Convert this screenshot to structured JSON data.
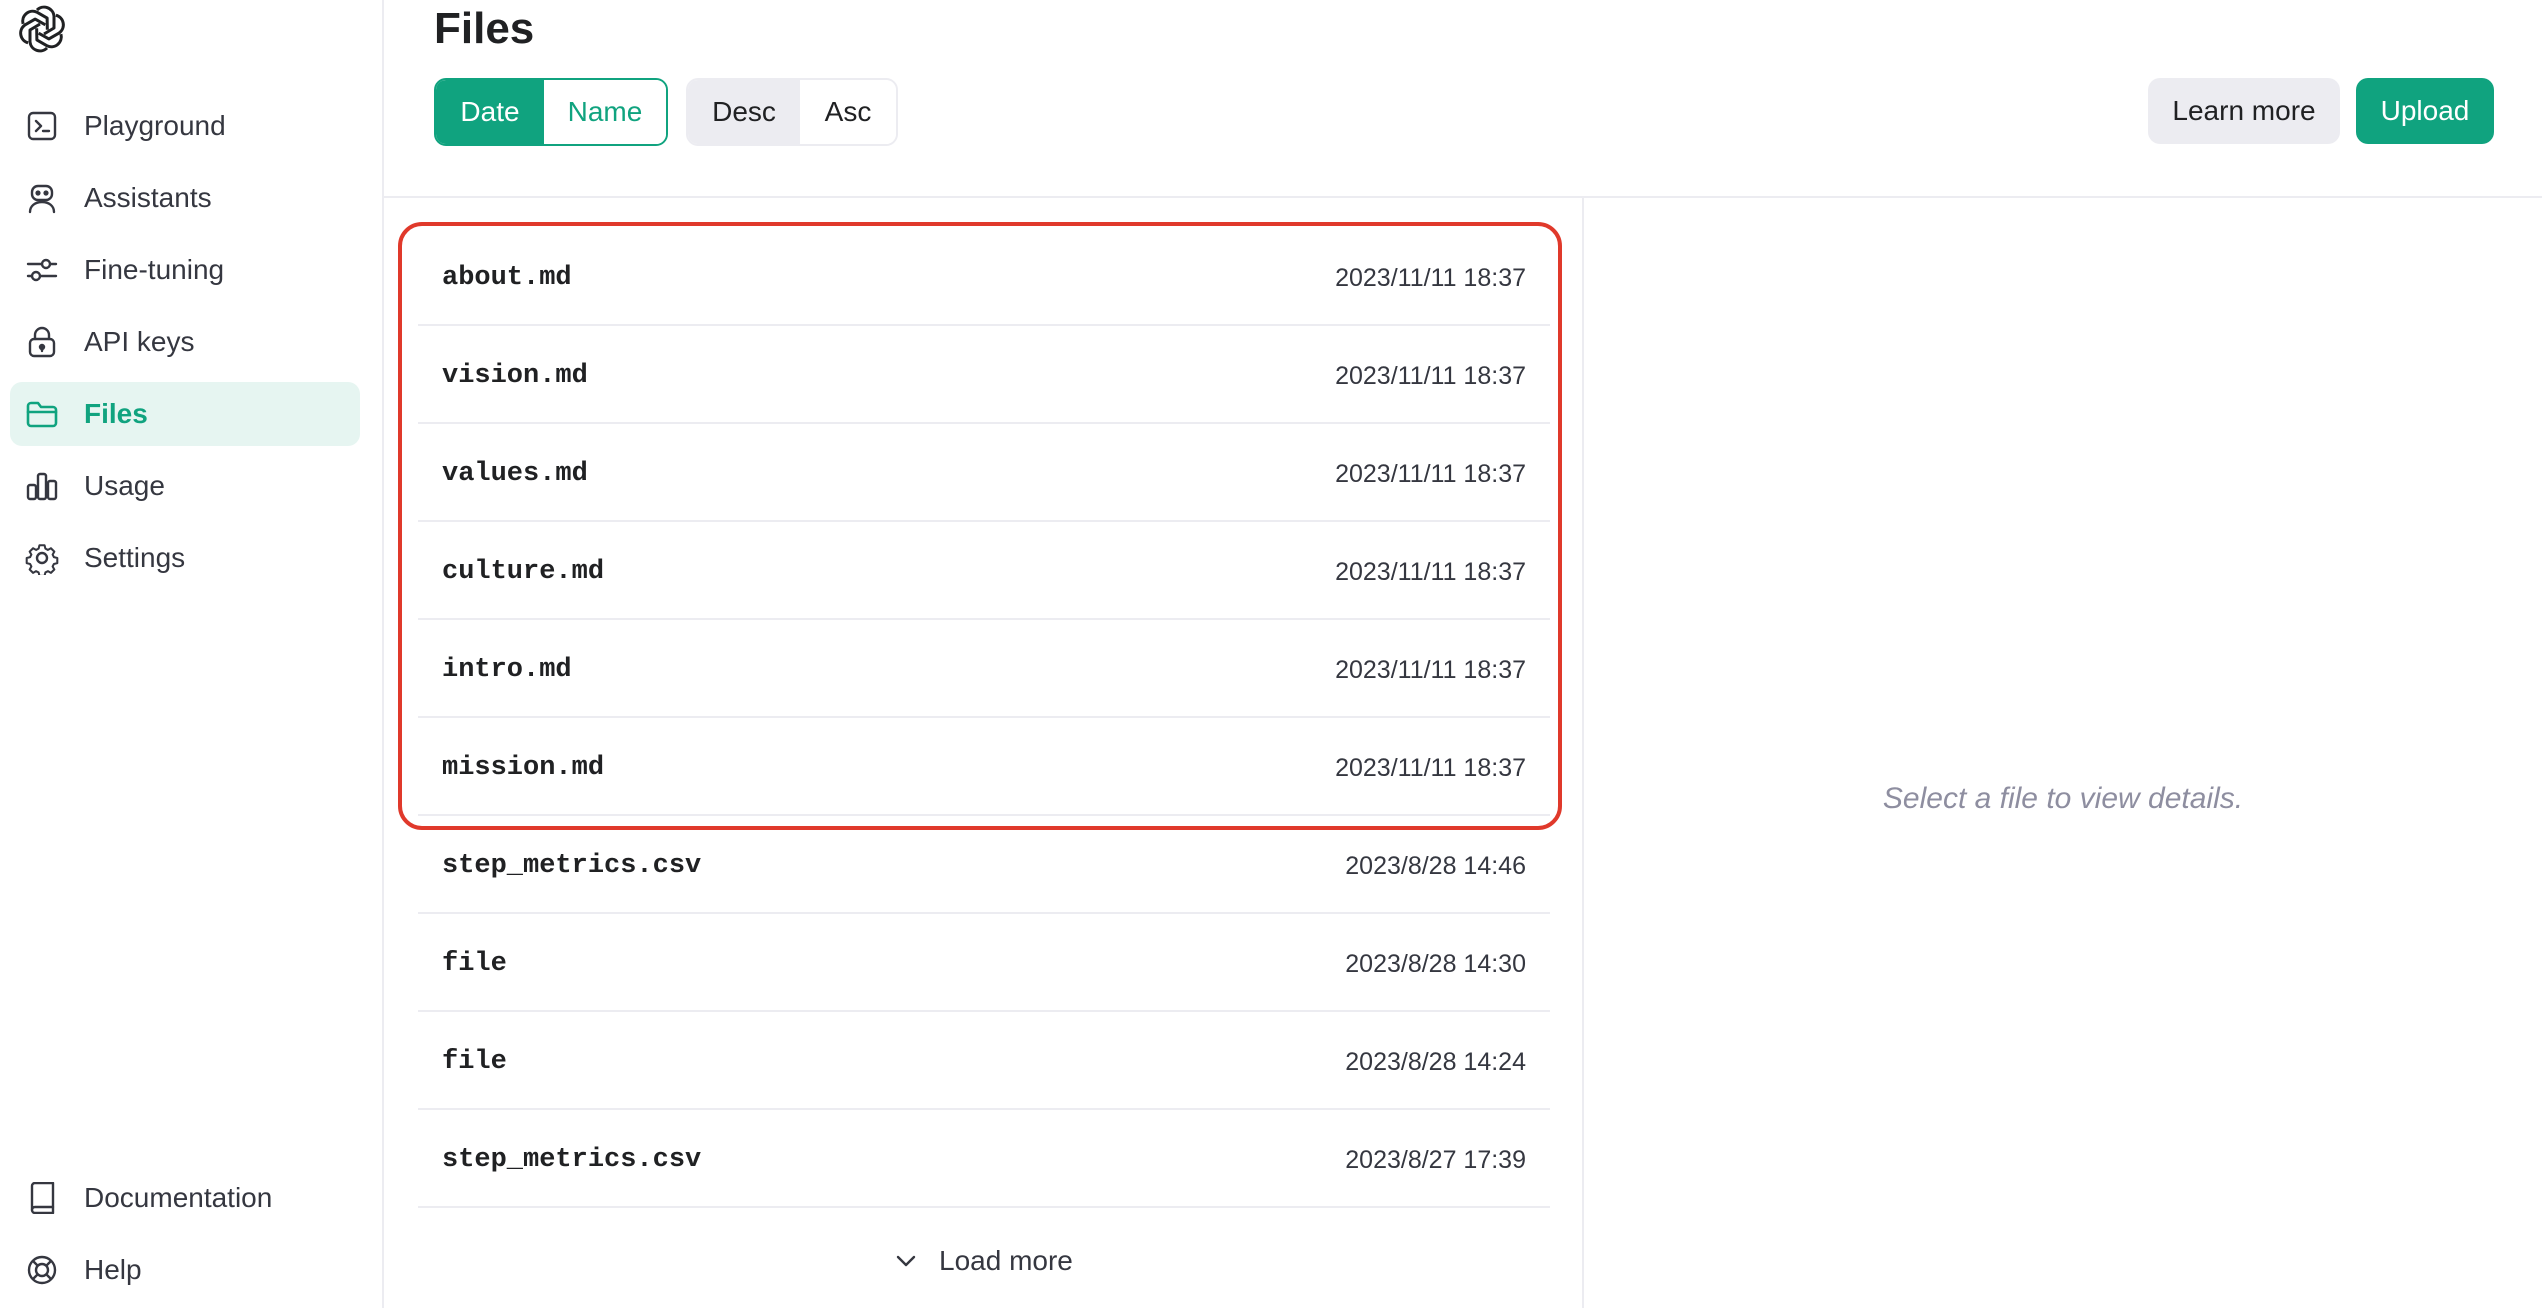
{
  "sidebar": {
    "items": [
      {
        "label": "Playground",
        "icon": "terminal-icon"
      },
      {
        "label": "Assistants",
        "icon": "robot-icon"
      },
      {
        "label": "Fine-tuning",
        "icon": "sliders-icon"
      },
      {
        "label": "API keys",
        "icon": "lock-icon"
      },
      {
        "label": "Files",
        "icon": "folder-icon",
        "active": true
      },
      {
        "label": "Usage",
        "icon": "bar-chart-icon"
      },
      {
        "label": "Settings",
        "icon": "gear-icon"
      }
    ],
    "bottom_items": [
      {
        "label": "Documentation",
        "icon": "book-icon"
      },
      {
        "label": "Help",
        "icon": "lifebuoy-icon"
      }
    ]
  },
  "header": {
    "title": "Files",
    "sort_by": {
      "date": "Date",
      "name": "Name",
      "selected": "Date"
    },
    "order": {
      "desc": "Desc",
      "asc": "Asc",
      "selected": "Desc"
    },
    "learn_more": "Learn more",
    "upload": "Upload"
  },
  "files": [
    {
      "name": "about.md",
      "date": "2023/11/11 18:37"
    },
    {
      "name": "vision.md",
      "date": "2023/11/11 18:37"
    },
    {
      "name": "values.md",
      "date": "2023/11/11 18:37"
    },
    {
      "name": "culture.md",
      "date": "2023/11/11 18:37"
    },
    {
      "name": "intro.md",
      "date": "2023/11/11 18:37"
    },
    {
      "name": "mission.md",
      "date": "2023/11/11 18:37"
    },
    {
      "name": "step_metrics.csv",
      "date": "2023/8/28 14:46"
    },
    {
      "name": "file",
      "date": "2023/8/28 14:30"
    },
    {
      "name": "file",
      "date": "2023/8/28 14:24"
    },
    {
      "name": "step_metrics.csv",
      "date": "2023/8/27 17:39"
    }
  ],
  "load_more": "Load more",
  "details": {
    "empty": "Select a file to view details."
  },
  "colors": {
    "accent": "#10a37f",
    "highlight": "#e0392b"
  }
}
